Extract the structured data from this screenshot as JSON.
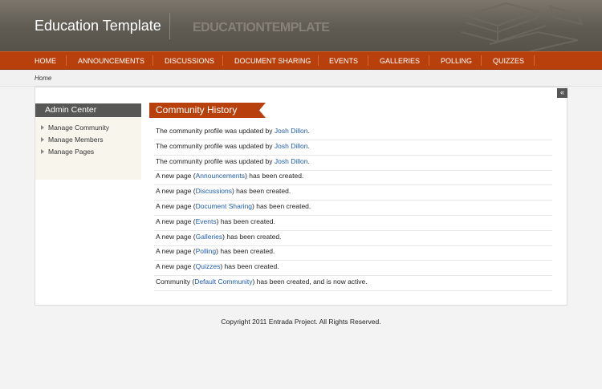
{
  "header": {
    "site_title": "Education Template",
    "stamp_text": "EDUCATIONTEMPLATE",
    "art_icon": "books-icon"
  },
  "nav": {
    "items": [
      "HOME",
      "ANNOUNCEMENTS",
      "DISCUSSIONS",
      "DOCUMENT SHARING",
      "EVENTS",
      "GALLERIES",
      "POLLING",
      "QUIZZES"
    ]
  },
  "breadcrumb": {
    "home": "Home"
  },
  "collapse_button": {
    "glyph": "«",
    "icon": "double-chevron-left-icon"
  },
  "admin_center": {
    "title": "Admin Center",
    "items": [
      "Manage Community",
      "Manage Members",
      "Manage Pages"
    ]
  },
  "community_history": {
    "title": "Community History",
    "entries": [
      {
        "before": "The community profile was updated by ",
        "link": "Josh Dillon",
        "after": "."
      },
      {
        "before": "The community profile was updated by ",
        "link": "Josh Dillon",
        "after": "."
      },
      {
        "before": "The community profile was updated by ",
        "link": "Josh Dillon",
        "after": "."
      },
      {
        "before": "A new page (",
        "link": "Announcements",
        "after": ") has been created."
      },
      {
        "before": "A new page (",
        "link": "Discussions",
        "after": ") has been created."
      },
      {
        "before": "A new page (",
        "link": "Document Sharing",
        "after": ") has been created."
      },
      {
        "before": "A new page (",
        "link": "Events",
        "after": ") has been created."
      },
      {
        "before": "A new page (",
        "link": "Galleries",
        "after": ") has been created."
      },
      {
        "before": "A new page (",
        "link": "Polling",
        "after": ") has been created."
      },
      {
        "before": "A new page (",
        "link": "Quizzes",
        "after": ") has been created."
      },
      {
        "before": "Community (",
        "link": "Default Community",
        "after": ") has been created, and is now active."
      }
    ]
  },
  "footer": {
    "copyright": "Copyright 2011 Entrada Project. All Rights Reserved."
  },
  "colors": {
    "nav": "#b8400c",
    "header": "#5f5a52",
    "link": "#1f5ca8",
    "admin_head": "#575756"
  }
}
